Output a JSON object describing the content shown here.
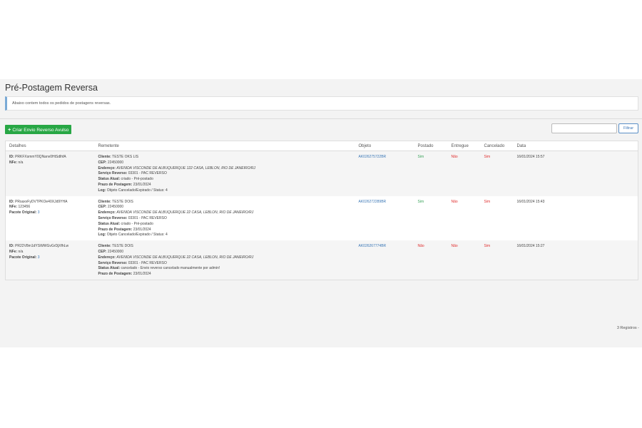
{
  "page": {
    "title": "Pré-Postagem Reversa",
    "info": "Abaixo contem todos os pedidos de postagens reversas."
  },
  "toolbar": {
    "create_icon": "+",
    "create_label": "Criar Envio Reverso Avulso",
    "search_placeholder": "",
    "filter_label": "Filtrar"
  },
  "table": {
    "headers": [
      "Detalhes",
      "Remetente",
      "Objeto",
      "Postado",
      "Entregue",
      "Cancelado",
      "Data"
    ],
    "labels": {
      "id": "ID:",
      "nfe": "NFe:",
      "pacote": "Pacote Original:",
      "cliente": "Cliente:",
      "cep": "CEP:",
      "endereco": "Endereço:",
      "servico": "Serviço Reverso:",
      "status": "Status Atual:",
      "prazo": "Prazo de Postagem:",
      "log": "Log:"
    },
    "rows": [
      {
        "id": "PRKFXsmmY0QNanv0HtSdlhfA",
        "nfe": "n/a",
        "cliente": "TESTE OKS LIS",
        "cep": "22450000",
        "endereco": "AVENIDA VISCONDE DE ALBUQUERQUE 122 CASA, LEBLON, RIO DE JANEIRO/RJ",
        "servico": "03301 - PAC REVERSO",
        "status": "criado - Pré-postado",
        "prazo": "23/01/2024",
        "log": "Objeto Cancelado/Expirado / Status: 4",
        "objeto": "AK026275722BR",
        "postado": "Sim",
        "entregue": "Não",
        "cancelado": "Sim",
        "data": "16/01/2024 15:57"
      },
      {
        "id": "PRsaxvFyDVTPKOe40XJd9YHA",
        "nfe": "123456",
        "pacote": "3",
        "cliente": "TESTE DOIS",
        "cep": "22450000",
        "endereco": "AVENIDA VISCONDE DE ALBUQUERQUE 22 CASA, LEBLON, RIO DE JANEIRO/RJ",
        "servico": "03301 - PAC REVERSO",
        "status": "criado - Pré-postado",
        "prazo": "23/01/2024",
        "log": "Objeto Cancelado/Expirado / Status: 4",
        "objeto": "AK026272289BR",
        "postado": "Sim",
        "entregue": "Não",
        "cancelado": "Sim",
        "data": "16/01/2024 15:43"
      },
      {
        "id": "PR22V8m1dYSWWGvGrDjXfhLw",
        "nfe": "n/a",
        "pacote": "3",
        "cliente": "TESTE DOIS",
        "cep": "22450000",
        "endereco": "AVENIDA VISCONDE DE ALBUQUERQUE 22 CASA, LEBLON, RIO DE JANEIRO/RJ",
        "servico": "03301 - PAC REVERSO",
        "status": "cancelado - Envio reverso cancelado manualmente por admin!",
        "prazo": "23/01/2024",
        "objeto": "AK026267774BR",
        "postado": "Não",
        "entregue": "Não",
        "cancelado": "Sim",
        "data": "16/01/2024 15:27"
      }
    ]
  },
  "footer": {
    "count": "3 Registros -"
  },
  "colors": {
    "success": "#28a745",
    "yes_green": "#3aa35a",
    "no_red": "#e03030",
    "link": "#3a77b6",
    "info_border": "#7aaad6"
  }
}
